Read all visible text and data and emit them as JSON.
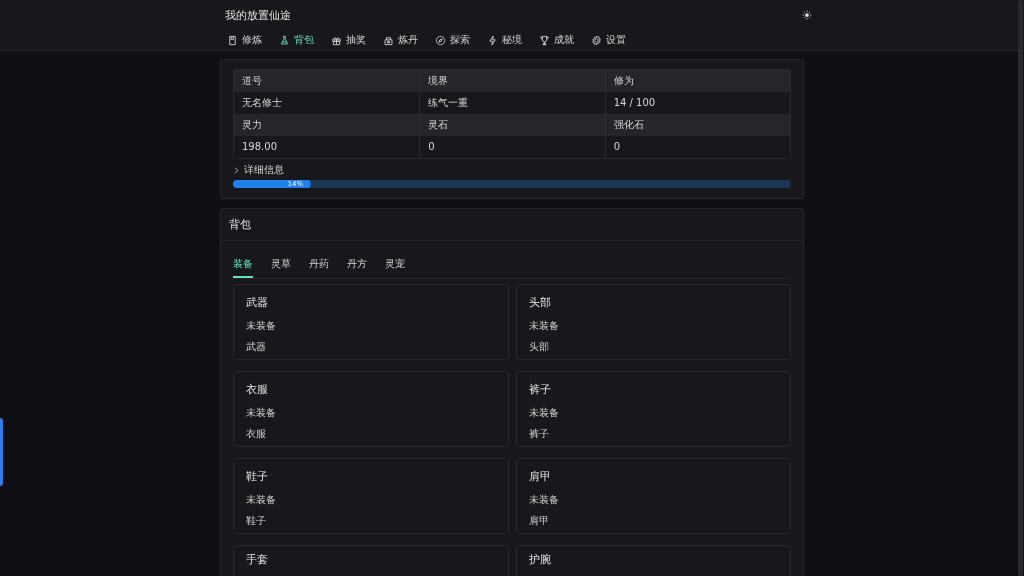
{
  "app": {
    "title": "我的放置仙途"
  },
  "nav": [
    {
      "label": "修炼",
      "selected": false
    },
    {
      "label": "背包",
      "selected": true
    },
    {
      "label": "抽奖",
      "selected": false
    },
    {
      "label": "炼丹",
      "selected": false
    },
    {
      "label": "探索",
      "selected": false
    },
    {
      "label": "秘境",
      "selected": false
    },
    {
      "label": "成就",
      "selected": false
    },
    {
      "label": "设置",
      "selected": false
    }
  ],
  "stats": {
    "rows": [
      {
        "kind": "head",
        "cells": [
          "道号",
          "境界",
          "修为"
        ]
      },
      {
        "kind": "value",
        "cells": [
          "无名修士",
          "练气一重",
          "14 / 100"
        ]
      },
      {
        "kind": "head",
        "cells": [
          "灵力",
          "灵石",
          "强化石"
        ]
      },
      {
        "kind": "value",
        "cells": [
          "198.00",
          "0",
          "0"
        ]
      }
    ],
    "details": {
      "label": "详细信息",
      "expanded": false
    },
    "progress": {
      "level": 0.14,
      "reading": "14%"
    }
  },
  "bag": {
    "title": "背包",
    "tabs": [
      {
        "label": "装备",
        "selected": true
      },
      {
        "label": "灵草",
        "selected": false
      },
      {
        "label": "丹药",
        "selected": false
      },
      {
        "label": "丹方",
        "selected": false
      },
      {
        "label": "灵宠",
        "selected": false
      }
    ],
    "slots": [
      {
        "title": "武器",
        "status": "未装备",
        "type": "武器"
      },
      {
        "title": "头部",
        "status": "未装备",
        "type": "头部"
      },
      {
        "title": "衣服",
        "status": "未装备",
        "type": "衣服"
      },
      {
        "title": "裤子",
        "status": "未装备",
        "type": "裤子"
      },
      {
        "title": "鞋子",
        "status": "未装备",
        "type": "鞋子"
      },
      {
        "title": "肩甲",
        "status": "未装备",
        "type": "肩甲"
      },
      {
        "title": "手套"
      },
      {
        "title": "护腕"
      }
    ]
  }
}
